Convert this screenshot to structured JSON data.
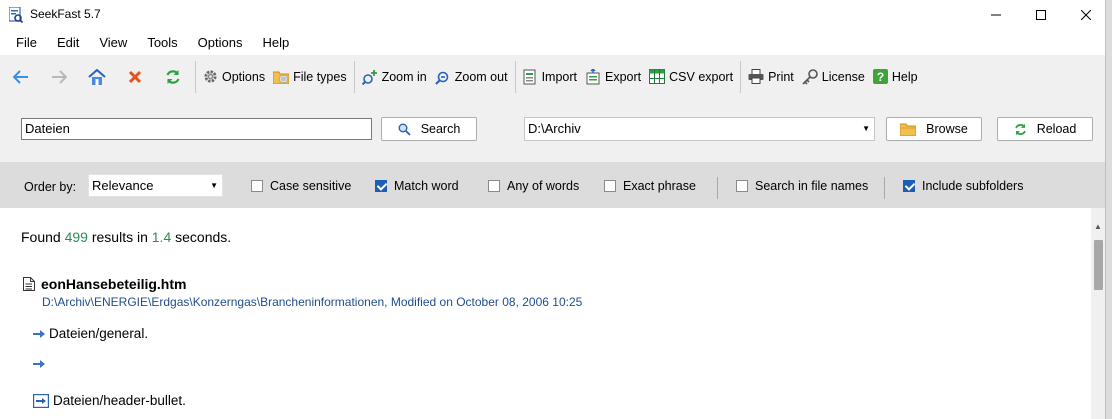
{
  "window": {
    "title": "SeekFast 5.7"
  },
  "menu": [
    "File",
    "Edit",
    "View",
    "Tools",
    "Options",
    "Help"
  ],
  "toolbar": {
    "options": "Options",
    "file_types": "File types",
    "zoom_in": "Zoom in",
    "zoom_out": "Zoom out",
    "import": "Import",
    "export": "Export",
    "csv_export": "CSV export",
    "print": "Print",
    "license": "License",
    "help": "Help"
  },
  "search": {
    "query": "Dateien",
    "search_label": "Search",
    "folder": "D:\\Archiv",
    "browse_label": "Browse",
    "reload_label": "Reload"
  },
  "options_bar": {
    "order_by_label": "Order by:",
    "order_by_value": "Relevance",
    "case_sensitive": "Case sensitive",
    "match_word": "Match word",
    "any_of_words": "Any of words",
    "exact_phrase": "Exact phrase",
    "search_in_file_names": "Search in file names",
    "include_subfolders": "Include subfolders",
    "checked": {
      "case_sensitive": false,
      "match_word": true,
      "any_of_words": false,
      "exact_phrase": false,
      "search_in_file_names": false,
      "include_subfolders": true
    }
  },
  "results": {
    "found_prefix": "Found",
    "count": "499",
    "mid": "results in",
    "time": "1.4",
    "suffix": "seconds.",
    "items": [
      {
        "file": "eonHansebeteilig.htm",
        "path": "D:\\Archiv\\ENERGIE\\Erdgas\\Konzerngas\\Brancheninformationen, Modified on October 08, 2006 10:25",
        "snippets": [
          "Dateien/general.",
          "",
          "Dateien/header-bullet."
        ]
      }
    ]
  },
  "colors": {
    "accent": "#1a5fb4",
    "count_green": "#2e8b57",
    "path_blue": "#1f4e8c",
    "stop_red": "#e8511a",
    "reload_green": "#2ea043"
  }
}
